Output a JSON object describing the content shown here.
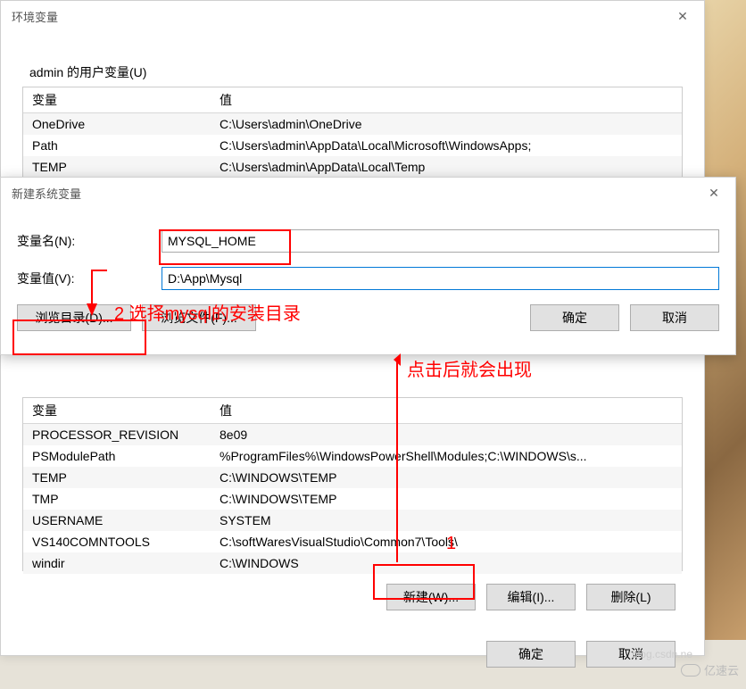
{
  "env_dialog": {
    "title": "环境变量",
    "user_section_label": "admin 的用户变量(U)",
    "table_col1": "变量",
    "table_col2": "值",
    "user_vars": [
      {
        "name": "OneDrive",
        "value": "C:\\Users\\admin\\OneDrive"
      },
      {
        "name": "Path",
        "value": "C:\\Users\\admin\\AppData\\Local\\Microsoft\\WindowsApps;"
      },
      {
        "name": "TEMP",
        "value": "C:\\Users\\admin\\AppData\\Local\\Temp"
      }
    ],
    "sys_vars": [
      {
        "name": "PROCESSOR_REVISION",
        "value": "8e09"
      },
      {
        "name": "PSModulePath",
        "value": "%ProgramFiles%\\WindowsPowerShell\\Modules;C:\\WINDOWS\\s..."
      },
      {
        "name": "TEMP",
        "value": "C:\\WINDOWS\\TEMP"
      },
      {
        "name": "TMP",
        "value": "C:\\WINDOWS\\TEMP"
      },
      {
        "name": "USERNAME",
        "value": "SYSTEM"
      },
      {
        "name": "VS140COMNTOOLS",
        "value": "C:\\softWaresVisualStudio\\Common7\\Tools\\"
      },
      {
        "name": "windir",
        "value": "C:\\WINDOWS"
      }
    ],
    "btn_new": "新建(W)...",
    "btn_edit": "编辑(I)...",
    "btn_delete": "删除(L)",
    "btn_ok": "确定",
    "btn_cancel": "取消"
  },
  "newvar_dialog": {
    "title": "新建系统变量",
    "name_label": "变量名(N):",
    "value_label": "变量值(V):",
    "name_value": "MYSQL_HOME",
    "value_value": "D:\\App\\Mysql",
    "btn_browse_dir": "浏览目录(D)...",
    "btn_browse_file": "浏览文件(F)...",
    "btn_ok": "确定",
    "btn_cancel": "取消"
  },
  "annotations": {
    "text1": "2 选择mysql的安装目录",
    "text2": "点击后就会出现",
    "text3": "1"
  },
  "watermark": "亿速云",
  "watermark2": "blog.csdn.ne"
}
